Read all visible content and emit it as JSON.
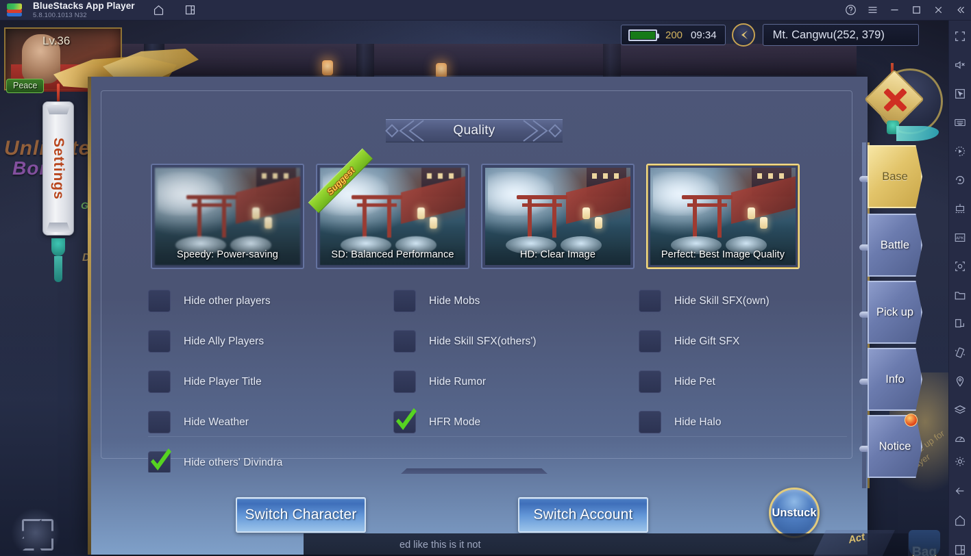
{
  "titlebar": {
    "app_name": "BlueStacks App Player",
    "version": "5.8.100.1013  N32",
    "home_icon": "home-icon",
    "instances_icon": "multi-instance-icon",
    "help_icon": "help-icon",
    "menu_icon": "hamburger-menu-icon",
    "minimize_icon": "minimize-icon",
    "maximize_icon": "maximize-icon",
    "close_icon": "close-icon",
    "collapse_icon": "collapse-sidebar-icon"
  },
  "game_hud": {
    "level": "Lv.36",
    "peace_badge": "Peace",
    "settings_tab": "Settings",
    "battery_value": "200",
    "time": "09:34",
    "location": "Mt. Cangwu(252, 379)",
    "banner_line1": "Unlimited",
    "banner_line2": "Bonus",
    "banner_line3": "Good",
    "banner_line4": "Deal",
    "chat_message": "ed like this is it not",
    "bag_label": "Bag",
    "act_label": "Act"
  },
  "dialog": {
    "title": "Quality",
    "close_icon": "close-x-icon",
    "quality_options": [
      {
        "label": "Speedy: Power-saving",
        "selected": false,
        "badge": null
      },
      {
        "label": "SD: Balanced Performance",
        "selected": false,
        "badge": "Suggest"
      },
      {
        "label": "HD: Clear Image",
        "selected": false,
        "badge": null
      },
      {
        "label": "Perfect: Best Image Quality",
        "selected": true,
        "badge": null
      }
    ],
    "columns": [
      [
        {
          "label": "Hide other players",
          "checked": false
        },
        {
          "label": "Hide Ally Players",
          "checked": false
        },
        {
          "label": "Hide Player Title",
          "checked": false
        },
        {
          "label": "Hide Weather",
          "checked": false
        },
        {
          "label": "Hide others' Divindra",
          "checked": true
        }
      ],
      [
        {
          "label": "Hide Mobs",
          "checked": false
        },
        {
          "label": "Hide Skill SFX(others')",
          "checked": false
        },
        {
          "label": "Hide Rumor",
          "checked": false
        },
        {
          "label": "HFR Mode",
          "checked": true
        }
      ],
      [
        {
          "label": "Hide Skill SFX(own)",
          "checked": false
        },
        {
          "label": "Hide Gift SFX",
          "checked": false
        },
        {
          "label": "Hide Pet",
          "checked": false
        },
        {
          "label": "Hide Halo",
          "checked": false
        }
      ]
    ],
    "buttons": {
      "switch_character": "Switch Character",
      "switch_account": "Switch Account",
      "unstuck": "Unstuck"
    }
  },
  "right_menu": {
    "items": [
      {
        "label": "Base",
        "active": true,
        "badge": false
      },
      {
        "label": "Battle",
        "active": false,
        "badge": false
      },
      {
        "label": "Pick up",
        "active": false,
        "badge": false
      },
      {
        "label": "Info",
        "active": false,
        "badge": false
      },
      {
        "label": "Notice",
        "active": false,
        "badge": true
      }
    ],
    "watermark": "Swipe up for player"
  },
  "sidebar": {
    "icons": [
      "fullscreen-icon",
      "mute-icon",
      "pointer-icon",
      "keyboard-controls-icon",
      "macro-recorder-icon",
      "rotate-icon",
      "multi-instance-manager-icon",
      "install-apk-icon",
      "screenshot-icon",
      "media-folder-icon",
      "rotate-screen-icon",
      "shake-icon",
      "location-icon",
      "layers-icon",
      "speed-meter-icon",
      "settings-gear-icon",
      "back-icon",
      "home-icon",
      "recents-icon"
    ]
  },
  "colors": {
    "accent_gold": "#e2c46a",
    "check_green": "#56d321",
    "panel_blue": "#4d5678",
    "button_blue": "#4d7fc6",
    "badge_red": "#e34a1c"
  }
}
